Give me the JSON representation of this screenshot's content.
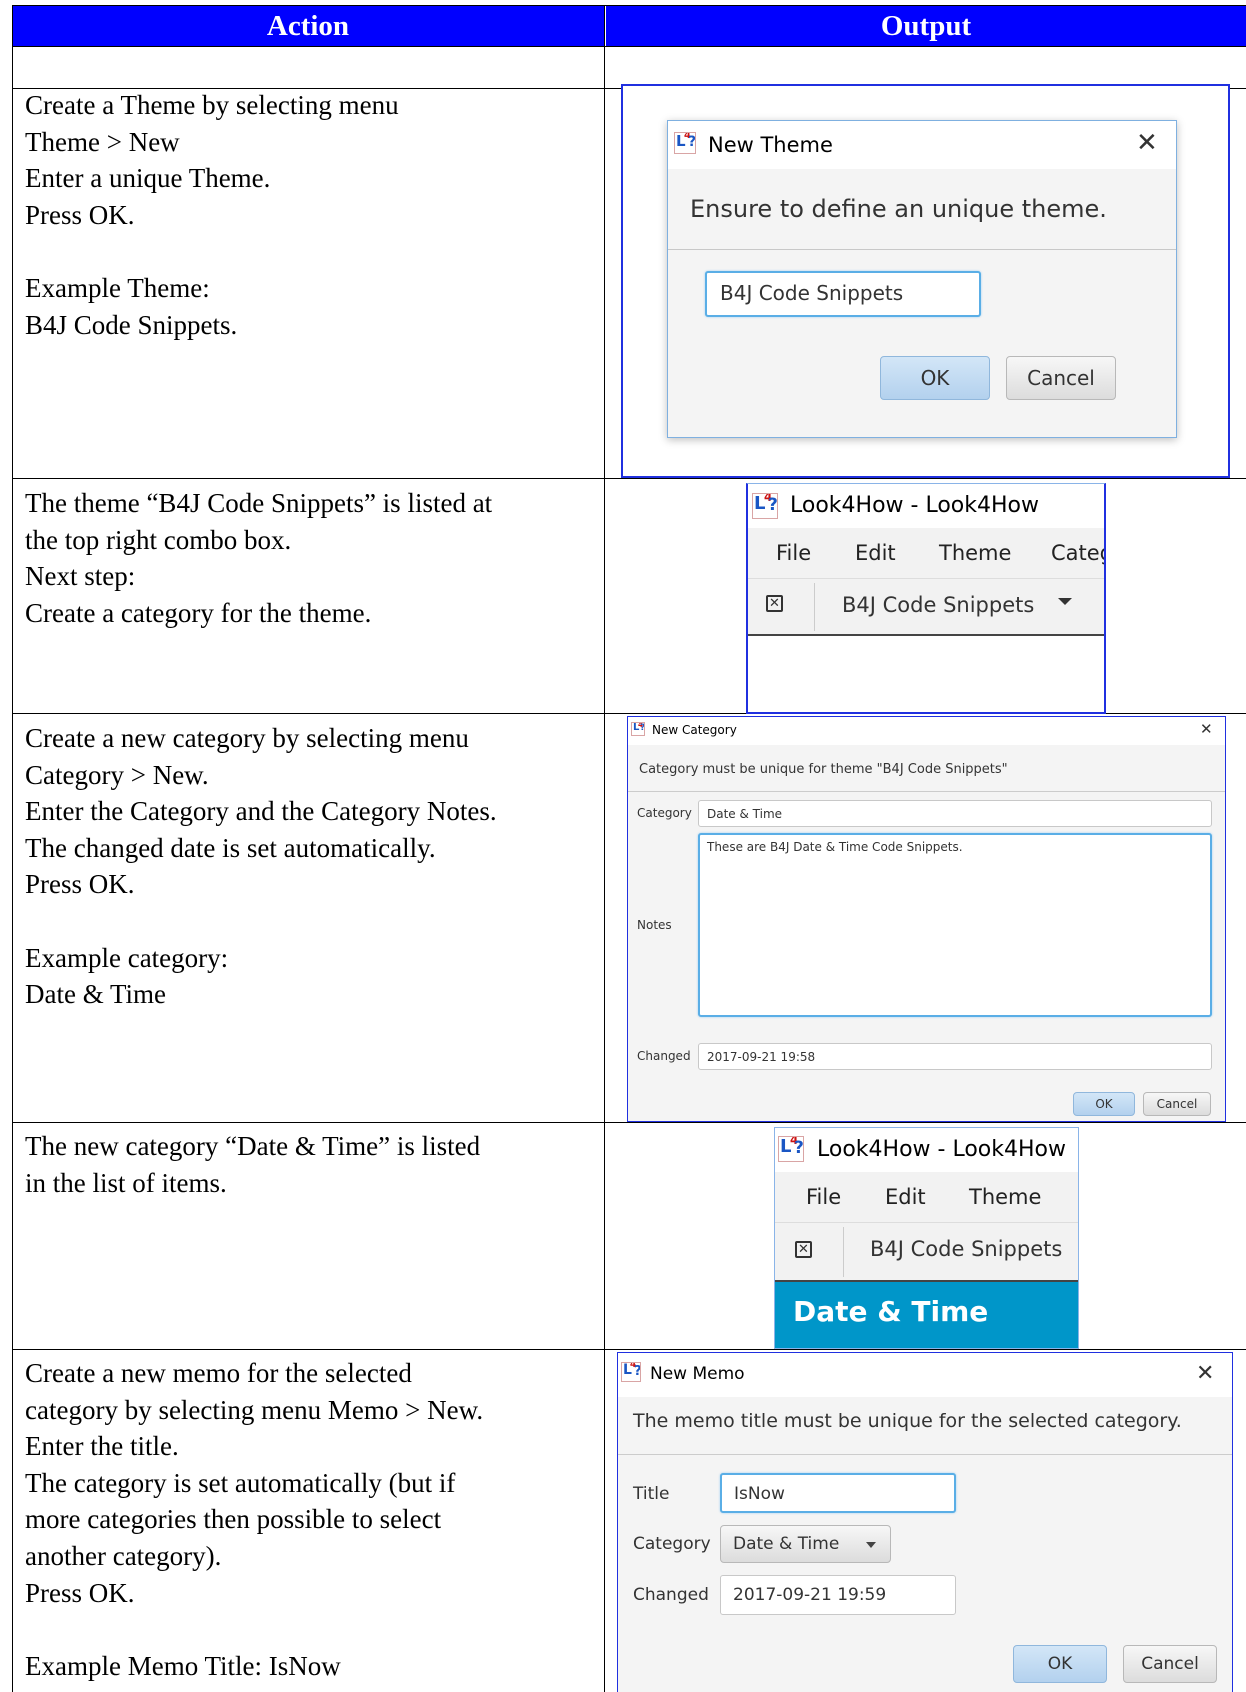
{
  "header": {
    "action": "Action",
    "output": "Output"
  },
  "rows": [
    {
      "lines": [
        "Create a Theme by selecting menu",
        "Theme > New",
        "Enter a unique Theme.",
        "Press OK.",
        "",
        "Example Theme:",
        "B4J Code Snippets."
      ]
    },
    {
      "lines": [
        "The theme “B4J Code Snippets” is listed at",
        "the top right combo box.",
        "Next step:",
        "Create a category for the theme."
      ]
    },
    {
      "lines": [
        "Create a new category by selecting menu",
        "Category > New.",
        "Enter the Category and the Category Notes.",
        "The changed date is set automatically.",
        "Press OK.",
        "",
        "Example category:",
        "Date & Time"
      ]
    },
    {
      "lines": [
        "The new category “Date & Time” is listed",
        "in the list of items."
      ]
    },
    {
      "lines": [
        "Create a new memo for the selected",
        "category by selecting menu Memo > New.",
        "Enter the title.",
        "The category is set automatically (but if",
        "more categories then possible to select",
        "another category).",
        "Press OK.",
        "",
        "Example Memo Title: IsNow"
      ]
    }
  ],
  "logo_text": "L4?",
  "theme_dialog": {
    "title": "New Theme",
    "message": "Ensure to define an unique theme.",
    "input_value": "B4J Code Snippets",
    "ok": "OK",
    "cancel": "Cancel"
  },
  "app_window_1": {
    "title": "Look4How - Look4How",
    "menu": [
      "File",
      "Edit",
      "Theme",
      "Categ"
    ],
    "combo_value": "B4J Code Snippets"
  },
  "category_dialog": {
    "title": "New Category",
    "message": "Category must be unique for theme \"B4J Code Snippets\"",
    "category_label": "Category",
    "category_value": "Date & Time",
    "notes_label": "Notes",
    "notes_value": "These are B4J Date & Time Code Snippets.",
    "changed_label": "Changed",
    "changed_value": "2017-09-21 19:58",
    "ok": "OK",
    "cancel": "Cancel"
  },
  "app_window_2": {
    "title": "Look4How - Look4How",
    "menu": [
      "File",
      "Edit",
      "Theme"
    ],
    "combo_value": "B4J Code Snippets",
    "selected_item": "Date & Time"
  },
  "memo_dialog": {
    "title": "New Memo",
    "message": "The memo title must be unique for the selected category.",
    "title_label": "Title",
    "title_value": "IsNow",
    "category_label": "Category",
    "category_value": "Date & Time",
    "changed_label": "Changed",
    "changed_value": "2017-09-21 19:59",
    "ok": "OK",
    "cancel": "Cancel"
  },
  "colors": {
    "header_bg": "#0000ff",
    "selection_bg": "#0096c9",
    "focus_border": "#5aaee6"
  }
}
